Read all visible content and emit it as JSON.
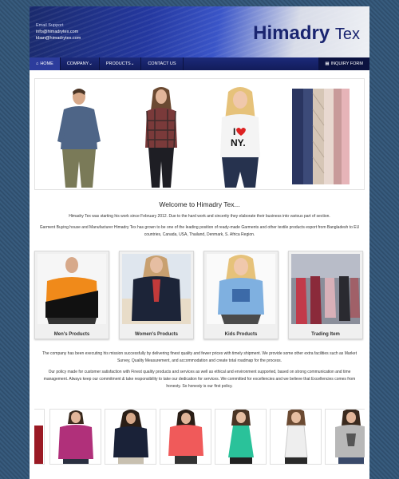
{
  "header": {
    "support_label": "Email Support",
    "email1": "info@himadrytex.com",
    "email2": "kban@himadrytex.com",
    "logo_bold": "Himadry",
    "logo_light": "Tex"
  },
  "nav": {
    "home": "HOME",
    "company": "COMPANY",
    "products": "PRODUCTS",
    "contact": "CONTACT US",
    "inquiry": "INQUIRY FORM"
  },
  "main": {
    "welcome_title": "Welcome to Himadry Tex...",
    "para1": "Himadry Tex was starting his work since February 2012. Due to the hard work and sincerity they elaborate their business into various part of section.",
    "para2": "Garment Buying house and Manufacturer Himadry Tex has grown to be one of the leading position of ready-made Garments and other textile products export from Bangladesh to EU countries, Canada, USA, Thailand, Denmark, S. Africa Region.",
    "para3": "The company has been executing his mission successfully by delivering finest quality and fewer prices with timely shipment. We provide some other extra facilities such as Market Survey, Quality Measurement, and accommodation and create total roadmap for the process.",
    "para4": "Our policy made for customer satisfaction with Finest quality products and services as well as ethical and environment supported, based on strong communication and time management. Always keep our commitment & take responsibility to take our dedication for services. We committed for excellencies and we believe that Excellencies comes from honesty. So honesty is our first policy."
  },
  "categories": [
    {
      "label": "Men's Products"
    },
    {
      "label": "Women's Products"
    },
    {
      "label": "Kids Products"
    },
    {
      "label": "Trading Item"
    }
  ],
  "colors": {
    "nav_bg": "#1c2a7a",
    "logo": "#1a2570",
    "background_denim": "#33587a"
  }
}
